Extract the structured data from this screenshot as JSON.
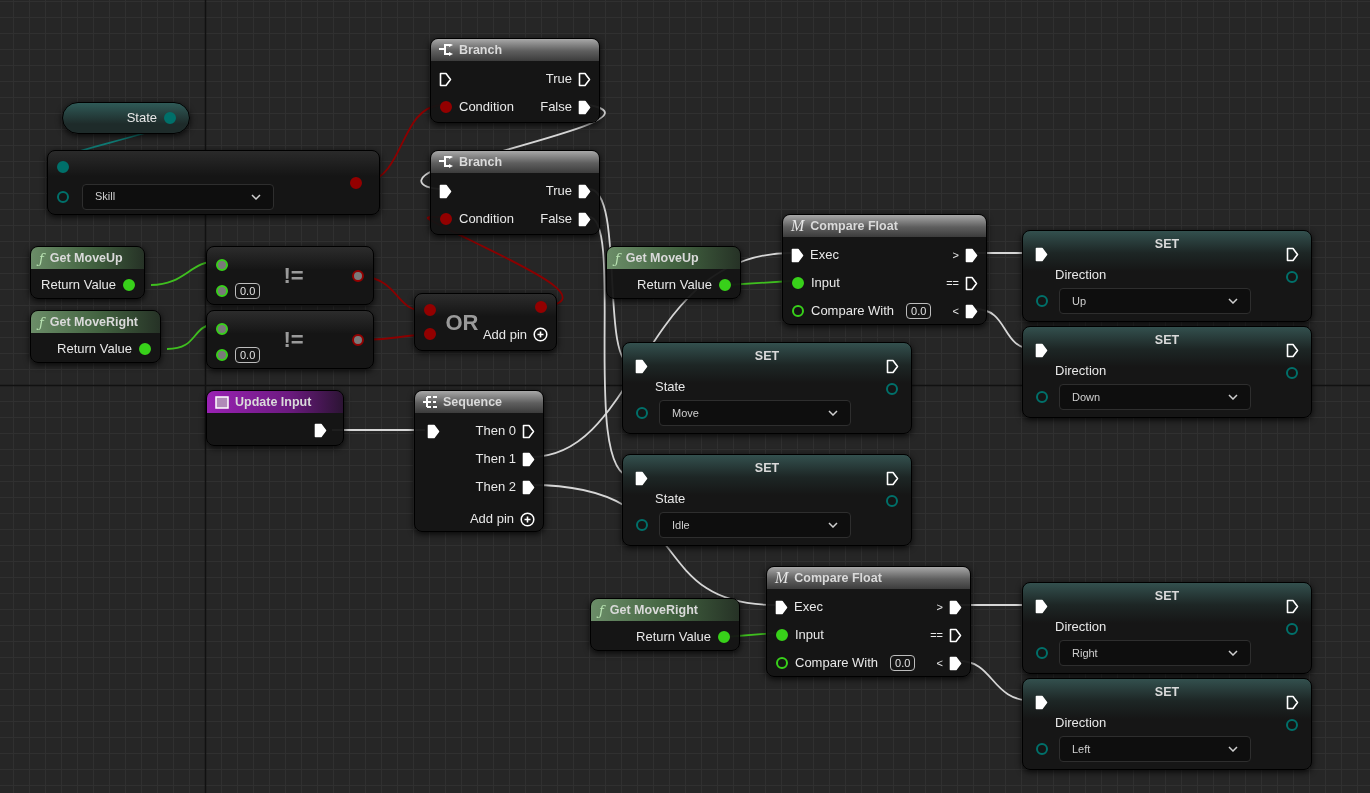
{
  "nodes": [
    {
      "kind": "variable",
      "label": "State",
      "output": {
        "kind": "enum",
        "connected": true
      }
    },
    {
      "kind": "enum_equal",
      "inputs": [
        {
          "kind": "enum",
          "connected": true
        },
        {
          "kind": "enum",
          "connected": false,
          "value": "Skill"
        }
      ],
      "output": {
        "kind": "bool",
        "connected": true
      }
    },
    {
      "kind": "branch",
      "title": "Branch",
      "exec_in": {
        "connected": false
      },
      "condition": {
        "label": "Condition",
        "kind": "bool",
        "connected": true
      },
      "outputs": [
        {
          "label": "True",
          "connected": false
        },
        {
          "label": "False",
          "connected": true
        }
      ]
    },
    {
      "kind": "branch",
      "title": "Branch",
      "exec_in": {
        "connected": true
      },
      "condition": {
        "label": "Condition",
        "kind": "bool",
        "connected": true
      },
      "outputs": [
        {
          "label": "True",
          "connected": true
        },
        {
          "label": "False",
          "connected": true
        }
      ]
    },
    {
      "kind": "function",
      "symbol": "ƒ",
      "title": "Get MoveUp",
      "output": {
        "label": "Return Value",
        "kind": "float",
        "connected": true
      }
    },
    {
      "kind": "function",
      "symbol": "ƒ",
      "title": "Get MoveRight",
      "output": {
        "label": "Return Value",
        "kind": "float",
        "connected": true
      }
    },
    {
      "kind": "compare_op",
      "symbol": "!=",
      "inputs": [
        {
          "kind": "float"
        },
        {
          "kind": "float",
          "value": "0.0"
        }
      ],
      "output": {
        "kind": "bool"
      }
    },
    {
      "kind": "compare_op",
      "symbol": "!=",
      "inputs": [
        {
          "kind": "float"
        },
        {
          "kind": "float",
          "value": "0.0"
        }
      ],
      "output": {
        "kind": "bool"
      }
    },
    {
      "kind": "or",
      "symbol": "OR",
      "inputs": [
        {
          "kind": "bool",
          "connected": true
        },
        {
          "kind": "bool",
          "connected": true
        }
      ],
      "output": {
        "kind": "bool",
        "connected": true
      },
      "add_pin": "Add pin"
    },
    {
      "kind": "event",
      "title": "Update Input",
      "exec_out": {
        "connected": true
      }
    },
    {
      "kind": "sequence",
      "title": "Sequence",
      "exec_in": {
        "connected": true
      },
      "outputs": [
        {
          "label": "Then 0",
          "connected": false
        },
        {
          "label": "Then 1",
          "connected": true
        },
        {
          "label": "Then 2",
          "connected": true
        }
      ],
      "add_pin": "Add pin"
    },
    {
      "kind": "function",
      "symbol": "ƒ",
      "title": "Get MoveUp",
      "output": {
        "label": "Return Value",
        "kind": "float",
        "connected": true
      }
    },
    {
      "kind": "compare",
      "symbol": "M",
      "title": "Compare Float",
      "inputs": [
        {
          "label": "Exec",
          "kind": "exec",
          "connected": true
        },
        {
          "label": "Input",
          "kind": "float",
          "connected": true
        },
        {
          "label": "Compare With",
          "kind": "float",
          "connected": false,
          "value": "0.0"
        }
      ],
      "outputs": [
        {
          "label": ">",
          "connected": true
        },
        {
          "label": "==",
          "connected": false
        },
        {
          "label": "<",
          "connected": true
        }
      ]
    },
    {
      "kind": "set",
      "title": "SET",
      "exec_in": {
        "connected": true
      },
      "exec_out": {
        "connected": false
      },
      "variable": "State",
      "value": "Move",
      "input": {
        "kind": "enum",
        "connected": false
      },
      "output": {
        "kind": "enum",
        "connected": false
      }
    },
    {
      "kind": "set",
      "title": "SET",
      "exec_in": {
        "connected": true
      },
      "exec_out": {
        "connected": false
      },
      "variable": "State",
      "value": "Idle",
      "input": {
        "kind": "enum",
        "connected": false
      },
      "output": {
        "kind": "enum",
        "connected": false
      }
    },
    {
      "kind": "set",
      "title": "SET",
      "exec_in": {
        "connected": true
      },
      "exec_out": {
        "connected": false
      },
      "variable": "Direction",
      "value": "Up",
      "input": {
        "kind": "enum",
        "connected": false
      },
      "output": {
        "kind": "enum",
        "connected": false
      }
    },
    {
      "kind": "set",
      "title": "SET",
      "exec_in": {
        "connected": true
      },
      "exec_out": {
        "connected": false
      },
      "variable": "Direction",
      "value": "Down",
      "input": {
        "kind": "enum",
        "connected": false
      },
      "output": {
        "kind": "enum",
        "connected": false
      }
    },
    {
      "kind": "function",
      "symbol": "ƒ",
      "title": "Get MoveRight",
      "output": {
        "label": "Return Value",
        "kind": "float",
        "connected": true
      }
    },
    {
      "kind": "compare",
      "symbol": "M",
      "title": "Compare Float",
      "inputs": [
        {
          "label": "Exec",
          "kind": "exec",
          "connected": true
        },
        {
          "label": "Input",
          "kind": "float",
          "connected": true
        },
        {
          "label": "Compare With",
          "kind": "float",
          "connected": false,
          "value": "0.0"
        }
      ],
      "outputs": [
        {
          "label": ">",
          "connected": true
        },
        {
          "label": "==",
          "connected": false
        },
        {
          "label": "<",
          "connected": true
        }
      ]
    },
    {
      "kind": "set",
      "title": "SET",
      "exec_in": {
        "connected": true
      },
      "exec_out": {
        "connected": false
      },
      "variable": "Direction",
      "value": "Right",
      "input": {
        "kind": "enum",
        "connected": false
      },
      "output": {
        "kind": "enum",
        "connected": false
      }
    },
    {
      "kind": "set",
      "title": "SET",
      "exec_in": {
        "connected": true
      },
      "exec_out": {
        "connected": false
      },
      "variable": "Direction",
      "value": "Left",
      "input": {
        "kind": "enum",
        "connected": false
      },
      "output": {
        "kind": "enum",
        "connected": false
      }
    }
  ]
}
